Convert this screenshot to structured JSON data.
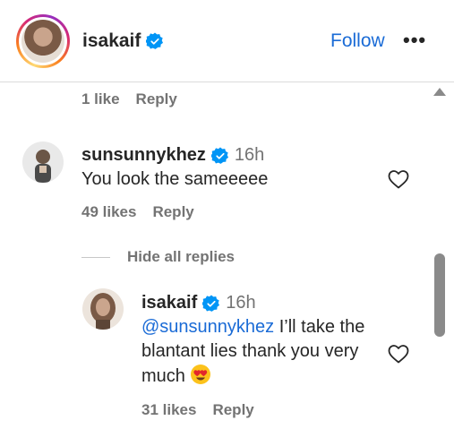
{
  "header": {
    "username": "isakaif",
    "follow_label": "Follow",
    "more_label": "•••"
  },
  "prev_comment": {
    "likes": "1 like",
    "reply_label": "Reply"
  },
  "comment": {
    "username": "sunsunnykhez",
    "time": "16h",
    "text": "You look the sameeeee",
    "likes": "49 likes",
    "reply_label": "Reply",
    "hide_replies_label": "Hide all replies"
  },
  "reply": {
    "username": "isakaif",
    "time": "16h",
    "mention": "@sunsunnykhez",
    "text_line1": " I’ll take the",
    "text_line2": "blantant lies thank you very",
    "text_line3": "much",
    "likes": "31 likes",
    "reply_label": "Reply"
  },
  "colors": {
    "accent": "#1a6bd6",
    "verified": "#0095f6",
    "muted": "#737373"
  },
  "icons": [
    "verified-badge-icon",
    "heart-icon",
    "more-icon",
    "heart-eyes-emoji-icon",
    "scroll-up-arrow-icon"
  ]
}
